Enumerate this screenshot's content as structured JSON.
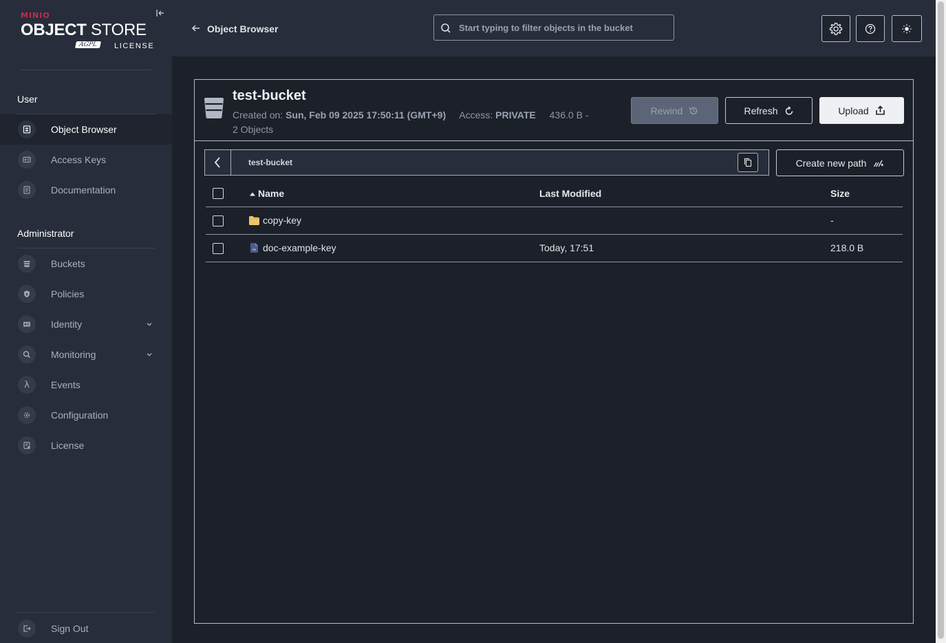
{
  "logo": {
    "brand": "MINIO",
    "title_bold": "OBJECT",
    "title_light": "STORE",
    "badge": "AGPL",
    "license": "LICENSE"
  },
  "sidebar": {
    "user_section": "User",
    "user_items": [
      {
        "label": "Object Browser",
        "icon": "object-browser-icon",
        "active": true
      },
      {
        "label": "Access Keys",
        "icon": "access-keys-icon"
      },
      {
        "label": "Documentation",
        "icon": "documentation-icon"
      }
    ],
    "admin_section": "Administrator",
    "admin_items": [
      {
        "label": "Buckets",
        "icon": "bucket-icon"
      },
      {
        "label": "Policies",
        "icon": "policy-icon"
      },
      {
        "label": "Identity",
        "icon": "identity-icon",
        "expandable": true
      },
      {
        "label": "Monitoring",
        "icon": "monitoring-icon",
        "expandable": true
      },
      {
        "label": "Events",
        "icon": "lambda-icon"
      },
      {
        "label": "Configuration",
        "icon": "gear-icon"
      },
      {
        "label": "License",
        "icon": "license-icon"
      }
    ],
    "sign_out": "Sign Out"
  },
  "header": {
    "title": "Object Browser",
    "search_placeholder": "Start typing to filter objects in the bucket"
  },
  "bucket": {
    "name": "test-bucket",
    "created_label": "Created on:",
    "created_value": "Sun, Feb 09 2025 17:50:11 (GMT+9)",
    "access_label": "Access:",
    "access_value": "PRIVATE",
    "size": "436.0 B -",
    "objects": "2 Objects"
  },
  "actions": {
    "rewind": "Rewind",
    "refresh": "Refresh",
    "upload": "Upload",
    "create_path": "Create new path"
  },
  "breadcrumb": {
    "path": "test-bucket"
  },
  "table": {
    "columns": [
      "Name",
      "Last Modified",
      "Size"
    ],
    "rows": [
      {
        "name": "copy-key",
        "type": "folder",
        "modified": "",
        "size": "-"
      },
      {
        "name": "doc-example-key",
        "type": "file",
        "modified": "Today, 17:51",
        "size": "218.0 B"
      }
    ]
  },
  "colors": {
    "sidebar_bg": "#272d3a",
    "main_bg": "#1c2029",
    "brand_red": "#c72c48",
    "folder_yellow": "#f0c46c",
    "file_blue": "#4c5a8c"
  }
}
